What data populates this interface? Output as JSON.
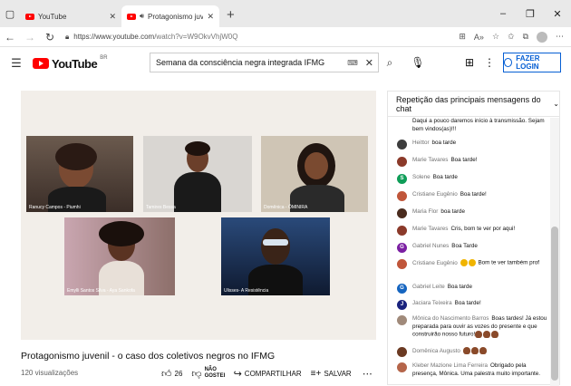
{
  "browser": {
    "tabs": [
      {
        "title": "YouTube",
        "active": false
      },
      {
        "title": "Protagonismo juvenil - o ca",
        "active": true
      }
    ],
    "url_host": "https://www.youtube.com",
    "url_path": "/watch?v=W9OkvVhjW0Q"
  },
  "youtube": {
    "logo_text": "YouTube",
    "logo_region": "BR",
    "search_query": "Semana da consciência negra integrada IFMG",
    "login_label": "FAZER LOGIN"
  },
  "video": {
    "title": "Protagonismo juvenil - o caso dos coletivos negros no IFMG",
    "views": "120 visualizações",
    "likes": "26",
    "dislike_label": "NÃO GOSTEI",
    "share_label": "COMPARTILHAR",
    "save_label": "SALVAR",
    "panels": [
      {
        "name": "Ranucy Campos - Piumhi"
      },
      {
        "name": "Tamires Bessa"
      },
      {
        "name": "Domênica - ÔMINIRA"
      },
      {
        "name": "Emylli Santos Silva - Aya Sankofa"
      },
      {
        "name": "Ulisses- A Resistência"
      }
    ]
  },
  "chat": {
    "header": "Repetição das principais mensagens do chat",
    "messages": [
      {
        "author": "",
        "text": "Daqui a pouco daremos início à transmissão. Sejam bem vindos(as)!!!",
        "color": "#ffffff"
      },
      {
        "author": "Heittor",
        "text": "boa tarde",
        "color": "#3d3d3d"
      },
      {
        "author": "Marie Tavares",
        "text": "Boa tarde!",
        "color": "#8b3a2a"
      },
      {
        "author": "Solene",
        "text": "Boa tarde",
        "color": "#0f9d58",
        "initial": "S"
      },
      {
        "author": "Cristiane Eugênio",
        "text": "Boa tarde!",
        "color": "#c0563a"
      },
      {
        "author": "Maria Flor",
        "text": "boa tarde",
        "color": "#4a2c1e"
      },
      {
        "author": "Marie Tavares",
        "text": "Cris, bom te ver por aqui!",
        "color": "#8b3a2a"
      },
      {
        "author": "Gabriel Nunes",
        "text": "Boa Tarde",
        "color": "#7b1fa2",
        "initial": "G"
      },
      {
        "author": "Cristiane Eugênio",
        "text": "Bom te ver também prof",
        "color": "#c0563a"
      },
      {
        "author": "Gabriel Leite",
        "text": "Boa tarde",
        "color": "#1565c0",
        "initial": "G"
      },
      {
        "author": "Jaciara Teixeira",
        "text": "Boa tarde!",
        "color": "#1a237e",
        "initial": "J"
      },
      {
        "author": "Mônica do Nascimento Barros",
        "text": "Boas tardes! Já estou preparada para ouvir as vozes do presente e que construirão nosso futuro!",
        "color": "#a08a7a"
      },
      {
        "author": "Domênica Augusto",
        "text": "",
        "color": "#6b3a22"
      },
      {
        "author": "Kleber Mazione Lima Ferreira",
        "text": "Obrigado pela presença, Mônica. Uma palestra muito importante.",
        "color": "#b5654a"
      }
    ]
  }
}
